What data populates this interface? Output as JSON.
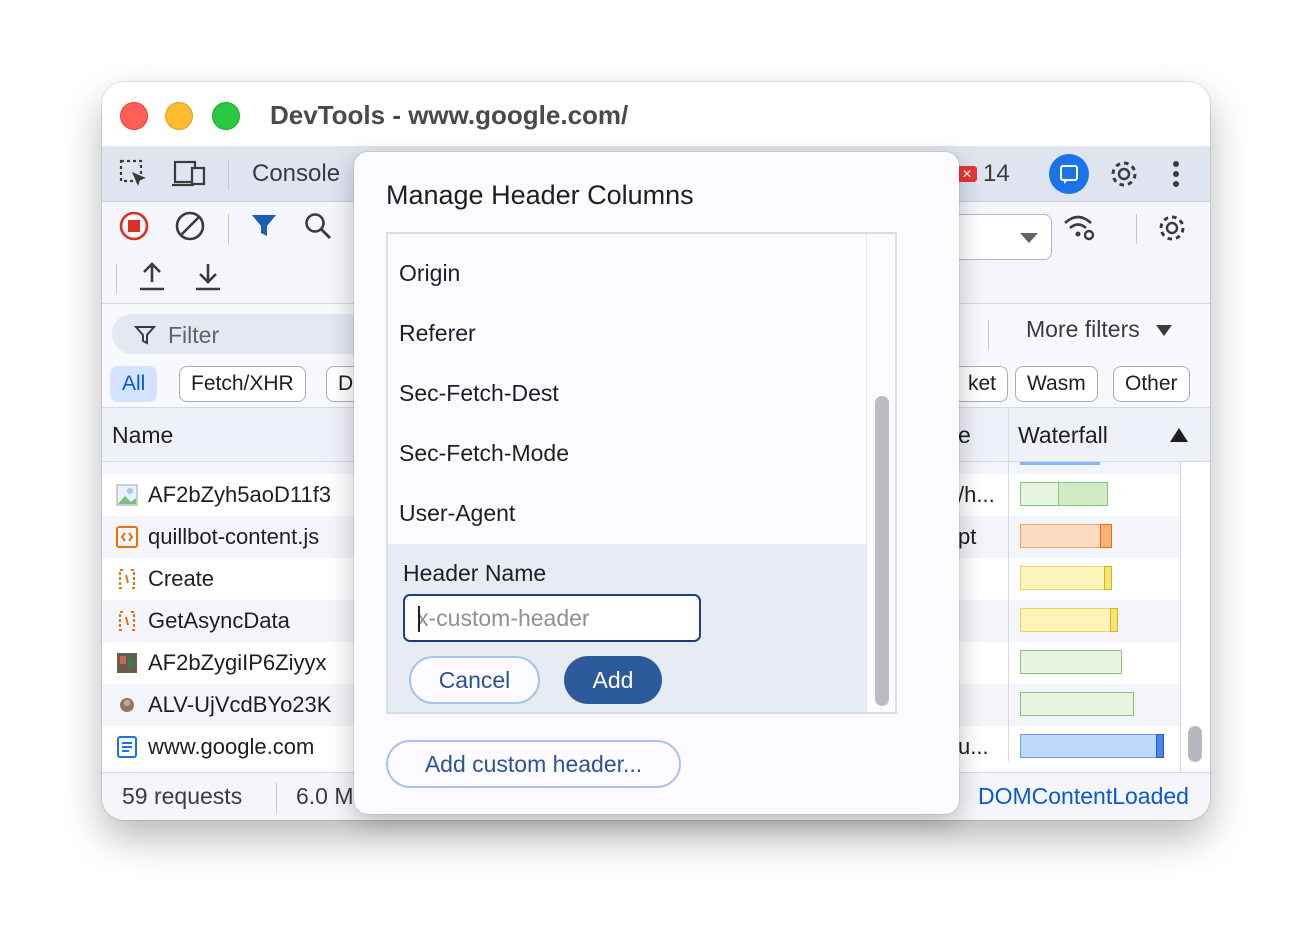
{
  "window": {
    "title": "DevTools - www.google.com/"
  },
  "main_toolbar": {
    "console_tab": "Console",
    "error_count": "14"
  },
  "network_toolbar": {},
  "filter_bar": {
    "filter_placeholder": "Filter",
    "more_filters": "More filters",
    "partial_label": "t",
    "chips": [
      "All",
      "Fetch/XHR",
      "D",
      "ket",
      "Wasm",
      "Other"
    ]
  },
  "grid": {
    "columns": {
      "name": "Name",
      "type_partial": "e",
      "waterfall": "Waterfall"
    },
    "rows": [
      {
        "name": "AF2bZyh5aoD11f3",
        "type": "/h...",
        "icon": "image-icon"
      },
      {
        "name": "quillbot-content.js",
        "type": "pt",
        "icon": "script-icon"
      },
      {
        "name": "Create",
        "type": "",
        "icon": "fetch-icon"
      },
      {
        "name": "GetAsyncData",
        "type": "",
        "icon": "fetch-icon"
      },
      {
        "name": "AF2bZygiIP6Ziyyx",
        "type": "",
        "icon": "image-icon"
      },
      {
        "name": "ALV-UjVcdBYo23K",
        "type": "",
        "icon": "image-icon"
      },
      {
        "name": "www.google.com",
        "type": "u...",
        "icon": "document-icon"
      }
    ]
  },
  "status": {
    "requests": "59 requests",
    "transferred": "6.0 M",
    "dom_content_loaded": "DOMContentLoaded"
  },
  "dialog": {
    "title": "Manage Header Columns",
    "headers": [
      "Origin",
      "Referer",
      "Sec-Fetch-Dest",
      "Sec-Fetch-Mode",
      "User-Agent"
    ],
    "editor": {
      "label": "Header Name",
      "placeholder": "x-custom-header",
      "cancel": "Cancel",
      "add": "Add"
    },
    "add_custom": "Add custom header..."
  }
}
